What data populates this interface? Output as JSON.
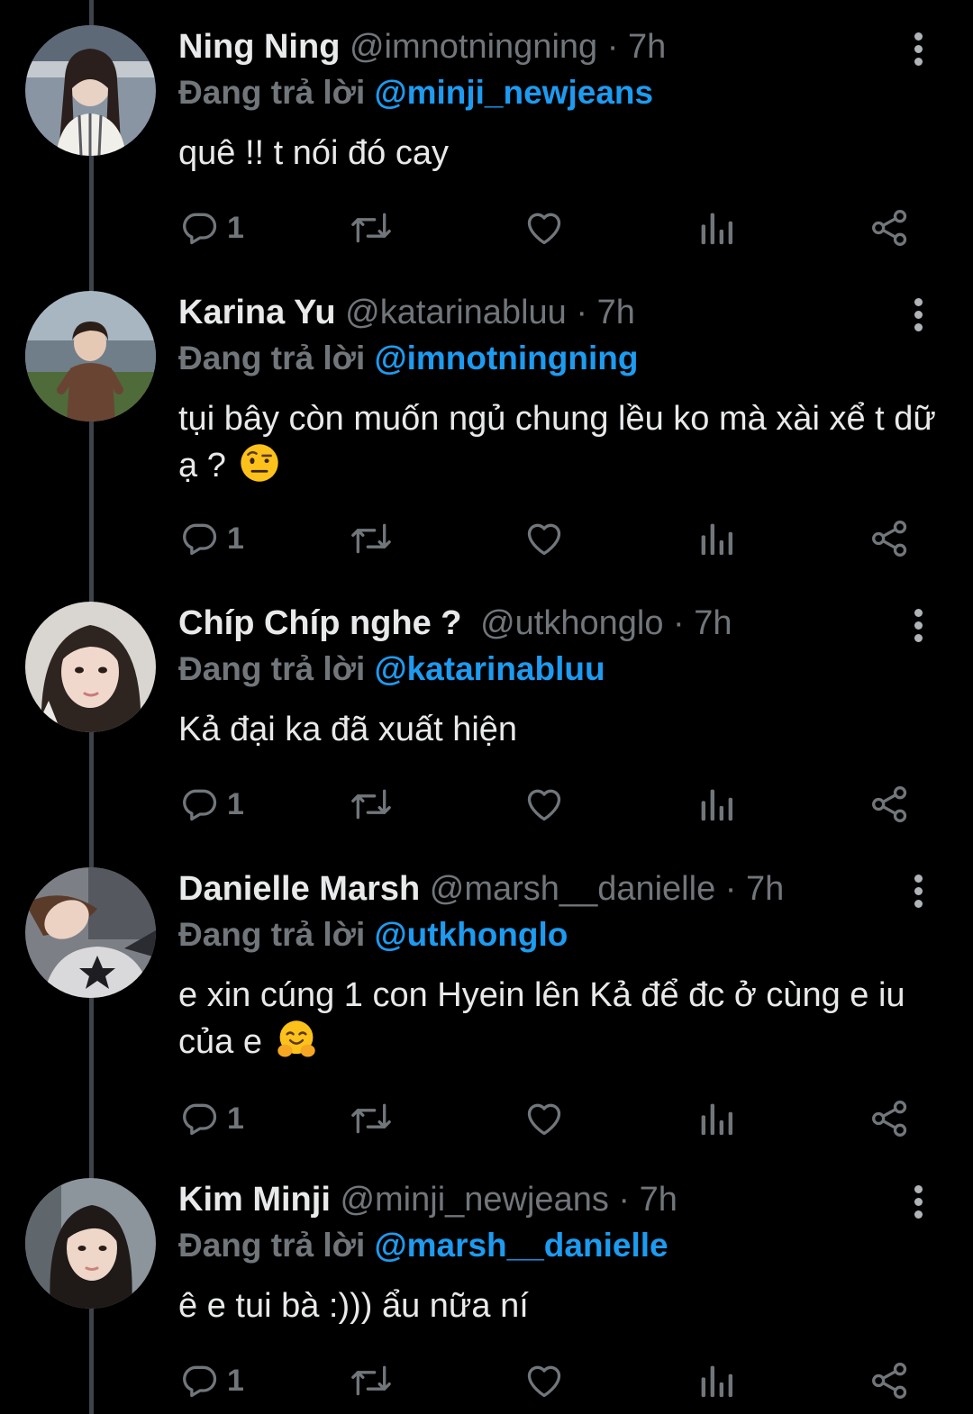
{
  "tweets": [
    {
      "name": "Ning Ning",
      "handle": "@imnotningning",
      "separator": "·",
      "time": "7h",
      "replying_label": "Đang trả lời",
      "replying_to": "@minji_newjeans",
      "text": "quê !! t nói đó cay",
      "emoji": "",
      "reply_count": "1"
    },
    {
      "name": "Karina Yu",
      "handle": "@katarinabluu",
      "separator": "·",
      "time": "7h",
      "replying_label": "Đang trả lời",
      "replying_to": "@imnotningning",
      "text": "tụi bây còn muốn ngủ chung lều ko mà xài xể t dữ ạ ?",
      "emoji": "face-with-raised-eyebrow",
      "reply_count": "1"
    },
    {
      "name": "Chíp Chíp nghe ?",
      "handle": "@utkhonglo",
      "separator": "·",
      "time": "7h",
      "replying_label": "Đang trả lời",
      "replying_to": "@katarinabluu",
      "text": "Kả đại ka đã xuất hiện",
      "emoji": "",
      "reply_count": "1"
    },
    {
      "name": "Danielle Marsh",
      "handle": "@marsh__danielle",
      "separator": "·",
      "time": "7h",
      "replying_label": "Đang trả lời",
      "replying_to": "@utkhonglo",
      "text": "e xin cúng 1 con Hyein lên Kả để đc ở cùng e iu của e",
      "emoji": "hugging-face",
      "reply_count": "1"
    },
    {
      "name": "Kim Minji",
      "handle": "@minji_newjeans",
      "separator": "·",
      "time": "7h",
      "replying_label": "Đang trả lời",
      "replying_to": "@marsh__danielle",
      "text": "ê e tui bà :))) ẩu nữa ní",
      "emoji": "",
      "reply_count": "1"
    }
  ],
  "icons": {
    "reply": "reply-icon",
    "retweet": "retweet-icon",
    "like": "heart-icon",
    "views": "views-icon",
    "share": "share-icon",
    "more": "more-options-icon"
  },
  "colors": {
    "background": "#000000",
    "text": "#e7e9ea",
    "secondary": "#71767b",
    "accent": "#1d9bf0",
    "thread_line": "#3d4349"
  }
}
